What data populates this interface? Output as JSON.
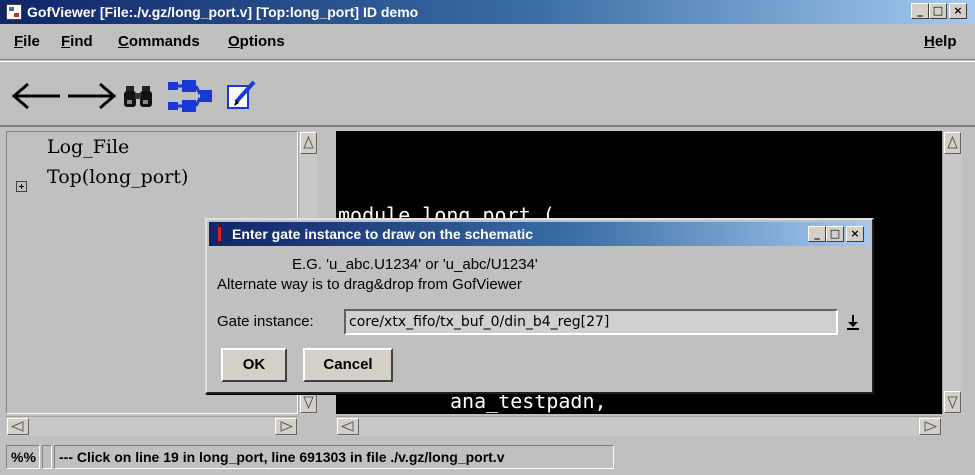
{
  "window": {
    "title": "GofViewer [File:./v.gz/long_port.v] [Top:long_port] ID demo",
    "minimize": "_",
    "maximize": "□",
    "close": "×"
  },
  "menu": {
    "file": "File",
    "find": "Find",
    "commands": "Commands",
    "options": "Options",
    "help": "Help"
  },
  "toolbar": {
    "icons": [
      "arrow-left-icon",
      "arrow-right-icon",
      "binoculars-icon",
      "schematic-icon",
      "edit-icon"
    ],
    "accent_color": "#1a3ad8"
  },
  "tree": {
    "items": [
      {
        "label": "Log_File"
      },
      {
        "label": "Top(long_port)",
        "expander": "+"
      }
    ]
  },
  "code": {
    "lines": [
      "module long_port (",
      "ana_testpadn,"
    ]
  },
  "status": {
    "percent": "%%",
    "message": "--- Click on line 19 in long_port, line 691303 in file ./v.gz/long_port.v"
  },
  "dialog": {
    "title": "Enter gate instance to draw on the schematic",
    "example": "E.G. 'u_abc.U1234' or 'u_abc/U1234'",
    "alternate": "Alternate way is to drag&drop from GofViewer",
    "gate_label": "Gate instance:",
    "gate_value": "core/xtx_fifo/tx_buf_0/din_b4_reg[27]",
    "ok": "OK",
    "cancel": "Cancel"
  }
}
